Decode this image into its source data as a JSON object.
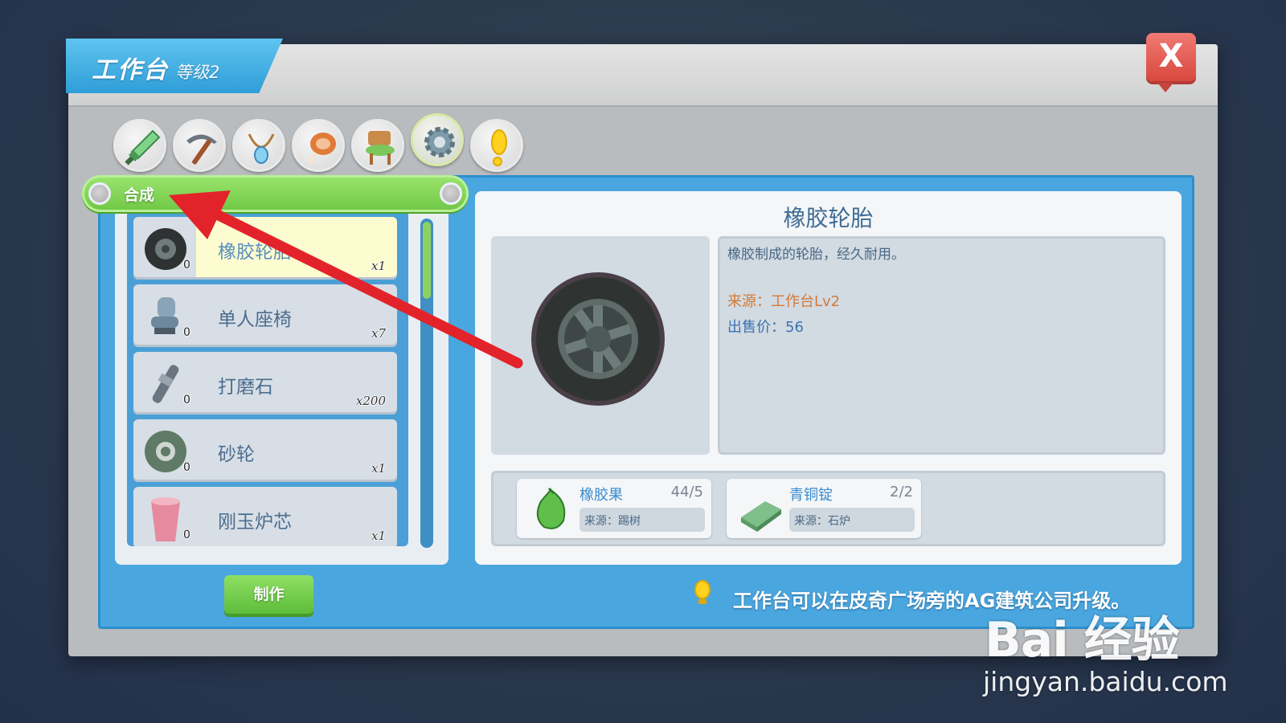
{
  "window": {
    "title": "工作台",
    "level": "等级2",
    "close_label": "X"
  },
  "categories": [
    {
      "icon": "sword-icon"
    },
    {
      "icon": "pickaxe-icon"
    },
    {
      "icon": "necklace-icon"
    },
    {
      "icon": "meat-icon"
    },
    {
      "icon": "chair-icon"
    },
    {
      "icon": "gear-icon",
      "active": true
    },
    {
      "icon": "exclamation-icon"
    }
  ],
  "section": {
    "label": "合成"
  },
  "recipes": [
    {
      "name": "橡胶轮胎",
      "count": "0",
      "qty": "x1",
      "icon": "tire-icon",
      "selected": true
    },
    {
      "name": "单人座椅",
      "count": "0",
      "qty": "x7",
      "icon": "seat-icon"
    },
    {
      "name": "打磨石",
      "count": "0",
      "qty": "x200",
      "icon": "grindstone-icon"
    },
    {
      "name": "砂轮",
      "count": "0",
      "qty": "x1",
      "icon": "grinding-wheel-icon"
    },
    {
      "name": "刚玉炉芯",
      "count": "0",
      "qty": "x1",
      "icon": "corundum-core-icon"
    }
  ],
  "make_button": "制作",
  "detail": {
    "title": "橡胶轮胎",
    "description": "橡胶制成的轮胎，经久耐用。",
    "source": "来源：工作台Lv2",
    "price": "出售价：56",
    "preview_icon": "tire-icon"
  },
  "materials": [
    {
      "name": "橡胶果",
      "count": "44/5",
      "source": "来源：踢树",
      "icon": "rubber-fruit-icon"
    },
    {
      "name": "青铜锭",
      "count": "2/2",
      "source": "来源：石炉",
      "icon": "bronze-ingot-icon"
    }
  ],
  "tip": {
    "text": "工作台可以在皮奇广场旁的AG建筑公司升级。",
    "icon": "lightbulb-icon"
  },
  "watermark": {
    "logo": "Bai 经验",
    "url": "jingyan.baidu.com"
  },
  "colors": {
    "accent_blue": "#4aa6df",
    "green": "#6fc744",
    "close_red": "#d9483f",
    "arrow_red": "#e3232a"
  }
}
